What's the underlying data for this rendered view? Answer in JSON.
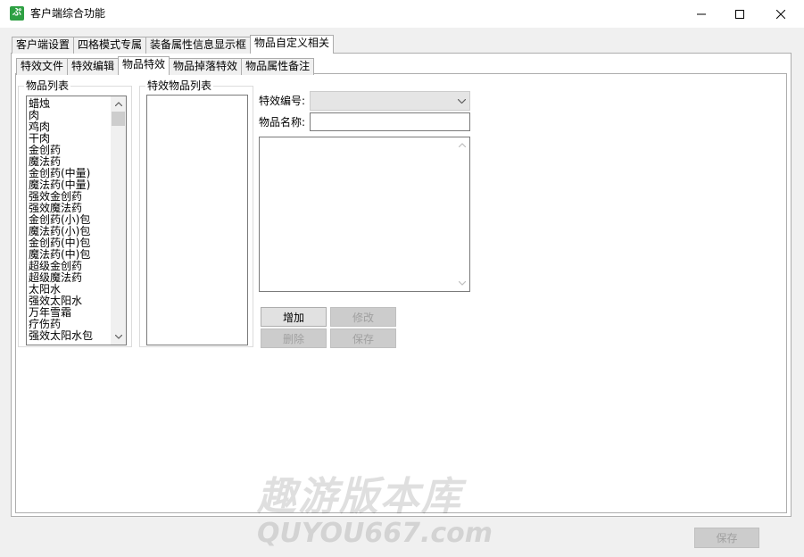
{
  "window": {
    "title": "客户端综合功能",
    "icon": "app-logo-icon"
  },
  "outer_tabs": [
    {
      "label": "客户端设置",
      "active": false
    },
    {
      "label": "四格模式专属",
      "active": false
    },
    {
      "label": "装备属性信息显示框",
      "active": false
    },
    {
      "label": "物品自定义相关",
      "active": true
    }
  ],
  "inner_tabs": [
    {
      "label": "特效文件",
      "active": false
    },
    {
      "label": "特效编辑",
      "active": false
    },
    {
      "label": "物品特效",
      "active": true
    },
    {
      "label": "物品掉落特效",
      "active": false
    },
    {
      "label": "物品属性备注",
      "active": false
    }
  ],
  "item_list": {
    "label": "物品列表",
    "items": [
      "蜡烛",
      "肉",
      "鸡肉",
      "干肉",
      "金创药",
      "魔法药",
      "金创药(中量)",
      "魔法药(中量)",
      "强效金创药",
      "强效魔法药",
      "金创药(小)包",
      "魔法药(小)包",
      "金创药(中)包",
      "魔法药(中)包",
      "超级金创药",
      "超级魔法药",
      "太阳水",
      "强效太阳水",
      "万年雪霜",
      "疗伤药",
      "强效太阳水包"
    ]
  },
  "effect_item_list": {
    "label": "特效物品列表",
    "items": []
  },
  "form": {
    "effect_id_label": "特效编号:",
    "effect_id_value": "",
    "item_name_label": "物品名称:",
    "item_name_value": ""
  },
  "buttons": {
    "add": "增加",
    "modify": "修改",
    "delete": "删除",
    "save": "保存",
    "footer_save": "保存"
  },
  "watermark": {
    "line1": "趣游版本库",
    "line2": "QUYOU667.com"
  }
}
